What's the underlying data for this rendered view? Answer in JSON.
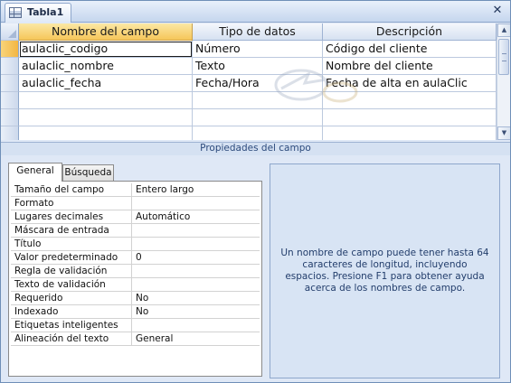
{
  "window": {
    "tab_title": "Tabla1",
    "close_glyph": "✕"
  },
  "grid": {
    "headers": [
      "Nombre del campo",
      "Tipo de datos",
      "Descripción"
    ],
    "rows": [
      {
        "name": "aulaclic_codigo",
        "type": "Número",
        "description": "Código del cliente"
      },
      {
        "name": "aulaclic_nombre",
        "type": "Texto",
        "description": "Nombre del cliente"
      },
      {
        "name": "aulaclic_fecha",
        "type": "Fecha/Hora",
        "description": "Fecha de alta en aulaClic"
      }
    ],
    "empty_rows": 3,
    "scroll_up_glyph": "▲",
    "scroll_down_glyph": "▼"
  },
  "properties": {
    "title": "Propiedades del campo",
    "tabs": [
      "General",
      "Búsqueda"
    ],
    "active_tab": "General",
    "rows": [
      {
        "name": "Tamaño del campo",
        "value": "Entero largo"
      },
      {
        "name": "Formato",
        "value": ""
      },
      {
        "name": "Lugares decimales",
        "value": "Automático"
      },
      {
        "name": "Máscara de entrada",
        "value": ""
      },
      {
        "name": "Título",
        "value": ""
      },
      {
        "name": "Valor predeterminado",
        "value": "0"
      },
      {
        "name": "Regla de validación",
        "value": ""
      },
      {
        "name": "Texto de validación",
        "value": ""
      },
      {
        "name": "Requerido",
        "value": "No"
      },
      {
        "name": "Indexado",
        "value": "No"
      },
      {
        "name": "Etiquetas inteligentes",
        "value": ""
      },
      {
        "name": "Alineación del texto",
        "value": "General"
      }
    ],
    "help_text": "Un nombre de campo puede tener hasta 64 caracteres de longitud, incluyendo espacios. Presione F1 para obtener ayuda acerca de los nombres de campo."
  },
  "colors": {
    "header_highlight": "#f6c65a",
    "panel_background": "#dfe8f6",
    "help_text": "#223d6b"
  }
}
